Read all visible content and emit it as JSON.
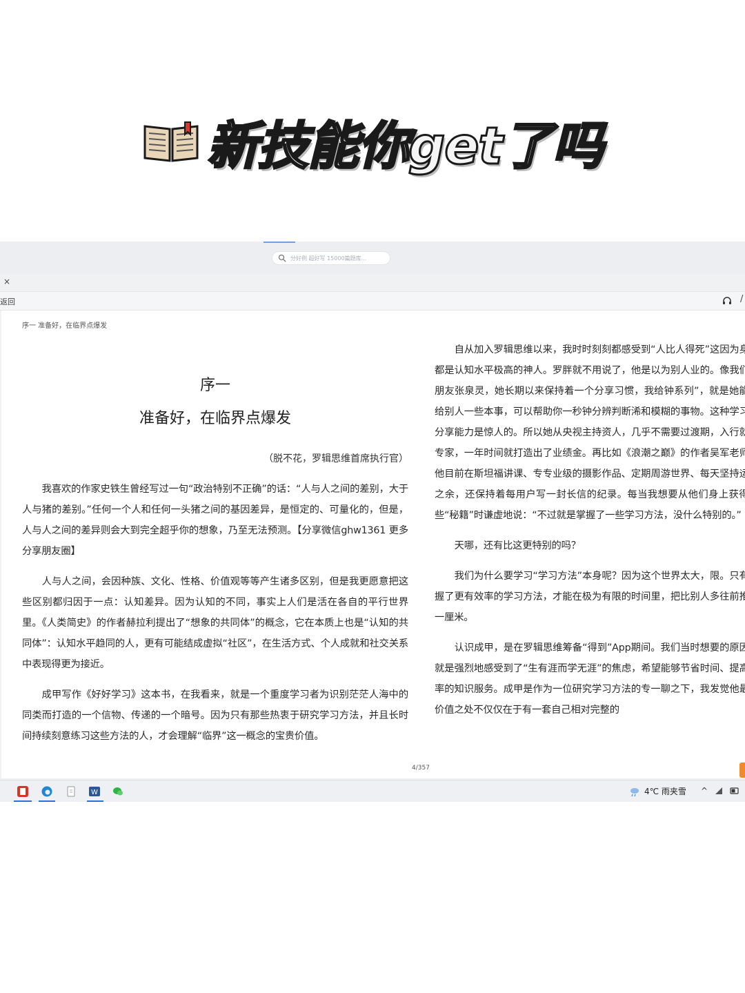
{
  "headline": {
    "icon": "open-book-icon",
    "text": "新技能你get了吗"
  },
  "browser": {
    "search_placeholder": "分好例 超好写 15000篇题库..."
  },
  "reader_toolbar": {
    "back_label": "返回",
    "close_glyph": "×",
    "slash_glyph": "/"
  },
  "page": {
    "running_header": "序一 准备好，在临界点爆发",
    "chapter_title": "序一",
    "chapter_subtitle": "准备好，在临界点爆发",
    "author_line": "（脱不花，罗辑思维首席执行官）",
    "left_paragraphs": [
      "我喜欢的作家史铁生曾经写过一句“政治特别不正确”的话：“人与人之间的差别，大于人与猪的差别。”任何一个人和任何一头猪之间的基因差异，是恒定的、可量化的，但是，人与人之间的差异则会大到完全超乎你的想象，乃至无法预测。【分享微信ghw1361 更多分享朋友圈】",
      "人与人之间，会因种族、文化、性格、价值观等等产生诸多区别，但是我更愿意把这些区别都归因于一点：认知差异。因为认知的不同，事实上人们是活在各自的平行世界里。《人类简史》的作者赫拉利提出了“想象的共同体”的概念，它在本质上也是“认知的共同体”：认知水平趋同的人，更有可能结成虚拟“社区”，在生活方式、个人成就和社交关系中表现得更为接近。",
      "成甲写作《好好学习》这本书，在我看来，就是一个重度学习者为识别茫茫人海中的同类而打造的一个信物、传递的一个暗号。因为只有那些热衷于研究学习方法，并且长时间持续刻意练习这些方法的人，才会理解“临界”这一概念的宝贵价值。"
    ],
    "right_paragraphs": [
      "自从加入罗辑思维以来，我时时刻刻都感受到“人比人得死”这因为身边都是认知水平极高的神人。罗胖就不用说了，他是以为别人业的。像我们的朋友张泉灵，她长期以来保持着一个分享习惯，我给钟系列”，就是她能教给别人一些本事，可以帮助你一秒钟分辨判断浠和模糊的事物。这种学习和分享能力是惊人的。所以她从央视主持资人，几乎不需要过渡期，入行就是专家，一年时间就打造出了业绩金。再比如《浪潮之巅》的作者吴军老师，他目前在斯坦福讲课、专专业级的摄影作品、定期周游世界、每天坚持运动之余，还保持着每用户写一封长信的纪录。每当我想要从他们身上获得一些“秘籍”时谦虚地说：“不过就是掌握了一些学习方法，没什么特别的。”",
      "天哪，还有比这更特别的吗？",
      "我们为什么要学习“学习方法”本身呢？因为这个世界太大，限。只有掌握了更有效率的学习方法，才能在极为有限的时间里，把比别人多往前推进一厘米。",
      "认识成甲，是在罗辑思维筹备“得到”App期间。我们当时想要的原因，就是强烈地感受到了“生有涯而学无涯”的焦虑，希望能够节省时间、提高效率的知识服务。成甲是作为一位研究学习方法的专一聊之下，我发觉他最有价值之处不仅仅在于有一套自己相对完整的"
    ],
    "page_number": "4/357"
  },
  "taskbar": {
    "apps": [
      "pdf-reader-icon",
      "edge-browser-icon",
      "file-icon",
      "word-icon",
      "wechat-icon"
    ],
    "weather_text": "4℃ 雨夹雪",
    "tray": [
      "^"
    ]
  },
  "colors": {
    "accent_blue": "#2f6fd6",
    "page_corner_orange": "#f08a2a"
  }
}
